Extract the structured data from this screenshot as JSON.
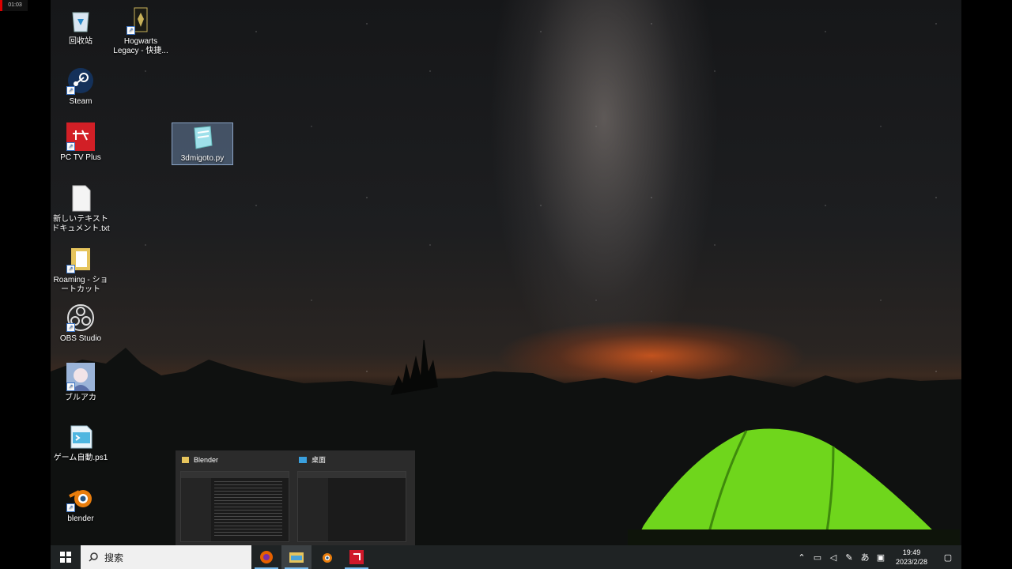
{
  "recorder": {
    "time": "01:03"
  },
  "desktop": {
    "icons": [
      {
        "label": "回收站"
      },
      {
        "label": "Hogwarts Legacy - 快捷..."
      },
      {
        "label": "Steam"
      },
      {
        "label": "PC TV Plus"
      },
      {
        "label": "3dmigoto.py"
      },
      {
        "label": "新しいテキスト ドキュメント.txt"
      },
      {
        "label": "Roaming - ショートカット"
      },
      {
        "label": "OBS Studio"
      },
      {
        "label": "ブルアカ"
      },
      {
        "label": "ゲーム自動.ps1"
      },
      {
        "label": "blender"
      }
    ]
  },
  "preview": {
    "windows": [
      {
        "title": "Blender"
      },
      {
        "title": "桌面"
      }
    ]
  },
  "taskbar": {
    "search_placeholder": "搜索",
    "tray": {
      "ime": "あ"
    },
    "clock": {
      "time": "19:49",
      "date": "2023/2/28"
    }
  },
  "colors": {
    "accent": "#76b9ed",
    "taskbar": "#1f2324"
  }
}
